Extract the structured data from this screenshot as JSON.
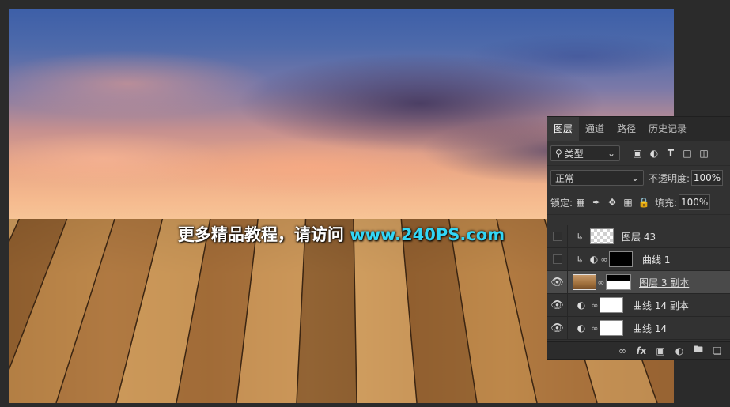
{
  "watermark": {
    "text": "更多精品教程，请访问 ",
    "url": "www.240PS.com"
  },
  "panel": {
    "tabs": [
      "图层",
      "通道",
      "路径",
      "历史记录"
    ],
    "filter": {
      "label": "类型"
    },
    "blend_mode": "正常",
    "opacity_label": "不透明度:",
    "opacity_value": "100%",
    "lock_label": "锁定:",
    "fill_label": "填充:",
    "fill_value": "100%",
    "layers": [
      {
        "name": "图层 43",
        "visible": false,
        "clipped": true
      },
      {
        "name": "曲线 1",
        "visible": false,
        "clipped": true
      },
      {
        "name": "图层 3 副本",
        "visible": true,
        "selected": true
      },
      {
        "name": "曲线 14 副本",
        "visible": true
      },
      {
        "name": "曲线 14",
        "visible": true
      }
    ],
    "footer_icons": [
      "link-icon",
      "fx-icon",
      "mask-icon",
      "adjustment-icon",
      "folder-icon",
      "new-layer-icon"
    ]
  },
  "colors": {
    "accent_url": "#33d6f5",
    "panel_bg": "#323232",
    "selected_row": "#4a4a4a"
  }
}
